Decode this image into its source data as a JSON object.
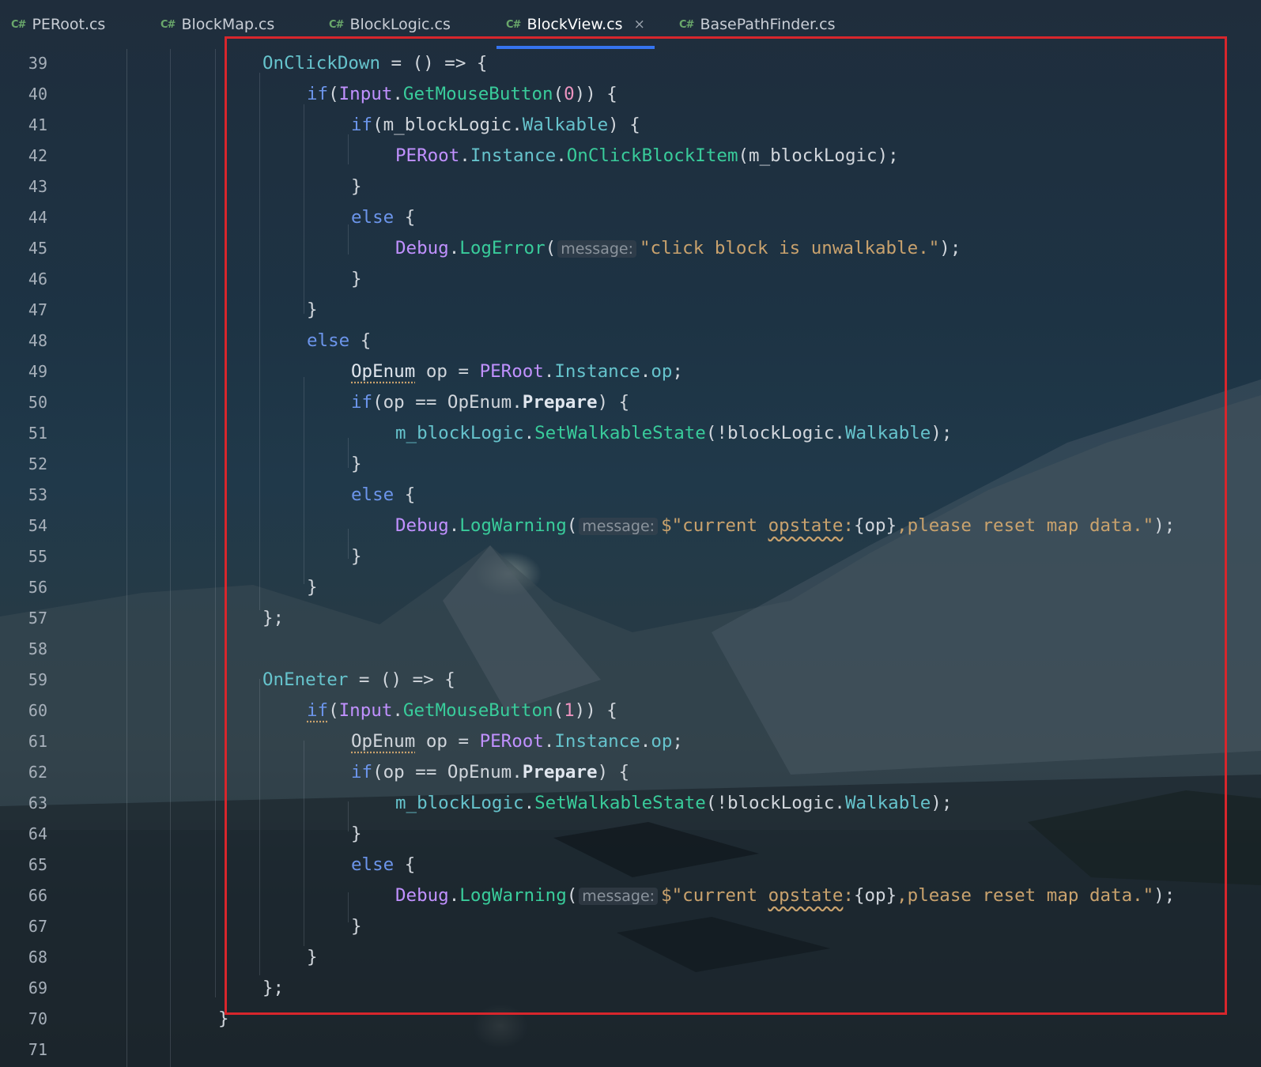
{
  "tabs": [
    {
      "lang": "C#",
      "label": "PERoot.cs",
      "active": false
    },
    {
      "lang": "C#",
      "label": "BlockMap.cs",
      "active": false
    },
    {
      "lang": "C#",
      "label": "BlockLogic.cs",
      "active": false
    },
    {
      "lang": "C#",
      "label": "BlockView.cs",
      "active": true,
      "close": "×"
    },
    {
      "lang": "C#",
      "label": "BasePathFinder.cs",
      "active": false
    }
  ],
  "line_numbers": [
    "39",
    "40",
    "41",
    "42",
    "43",
    "44",
    "45",
    "46",
    "47",
    "48",
    "49",
    "50",
    "51",
    "52",
    "53",
    "54",
    "55",
    "56",
    "57",
    "58",
    "59",
    "60",
    "61",
    "62",
    "63",
    "64",
    "65",
    "66",
    "67",
    "68",
    "69",
    "70",
    "71"
  ],
  "hints": {
    "message": "message:"
  },
  "colors": {
    "keyword": "#6c95eb",
    "method": "#39cc9b",
    "class": "#c191ff",
    "property": "#66c3cc",
    "string": "#c9a26d",
    "number": "#ed94c0",
    "highlight_box": "#d8262c",
    "active_tab_underline": "#3574f0"
  }
}
